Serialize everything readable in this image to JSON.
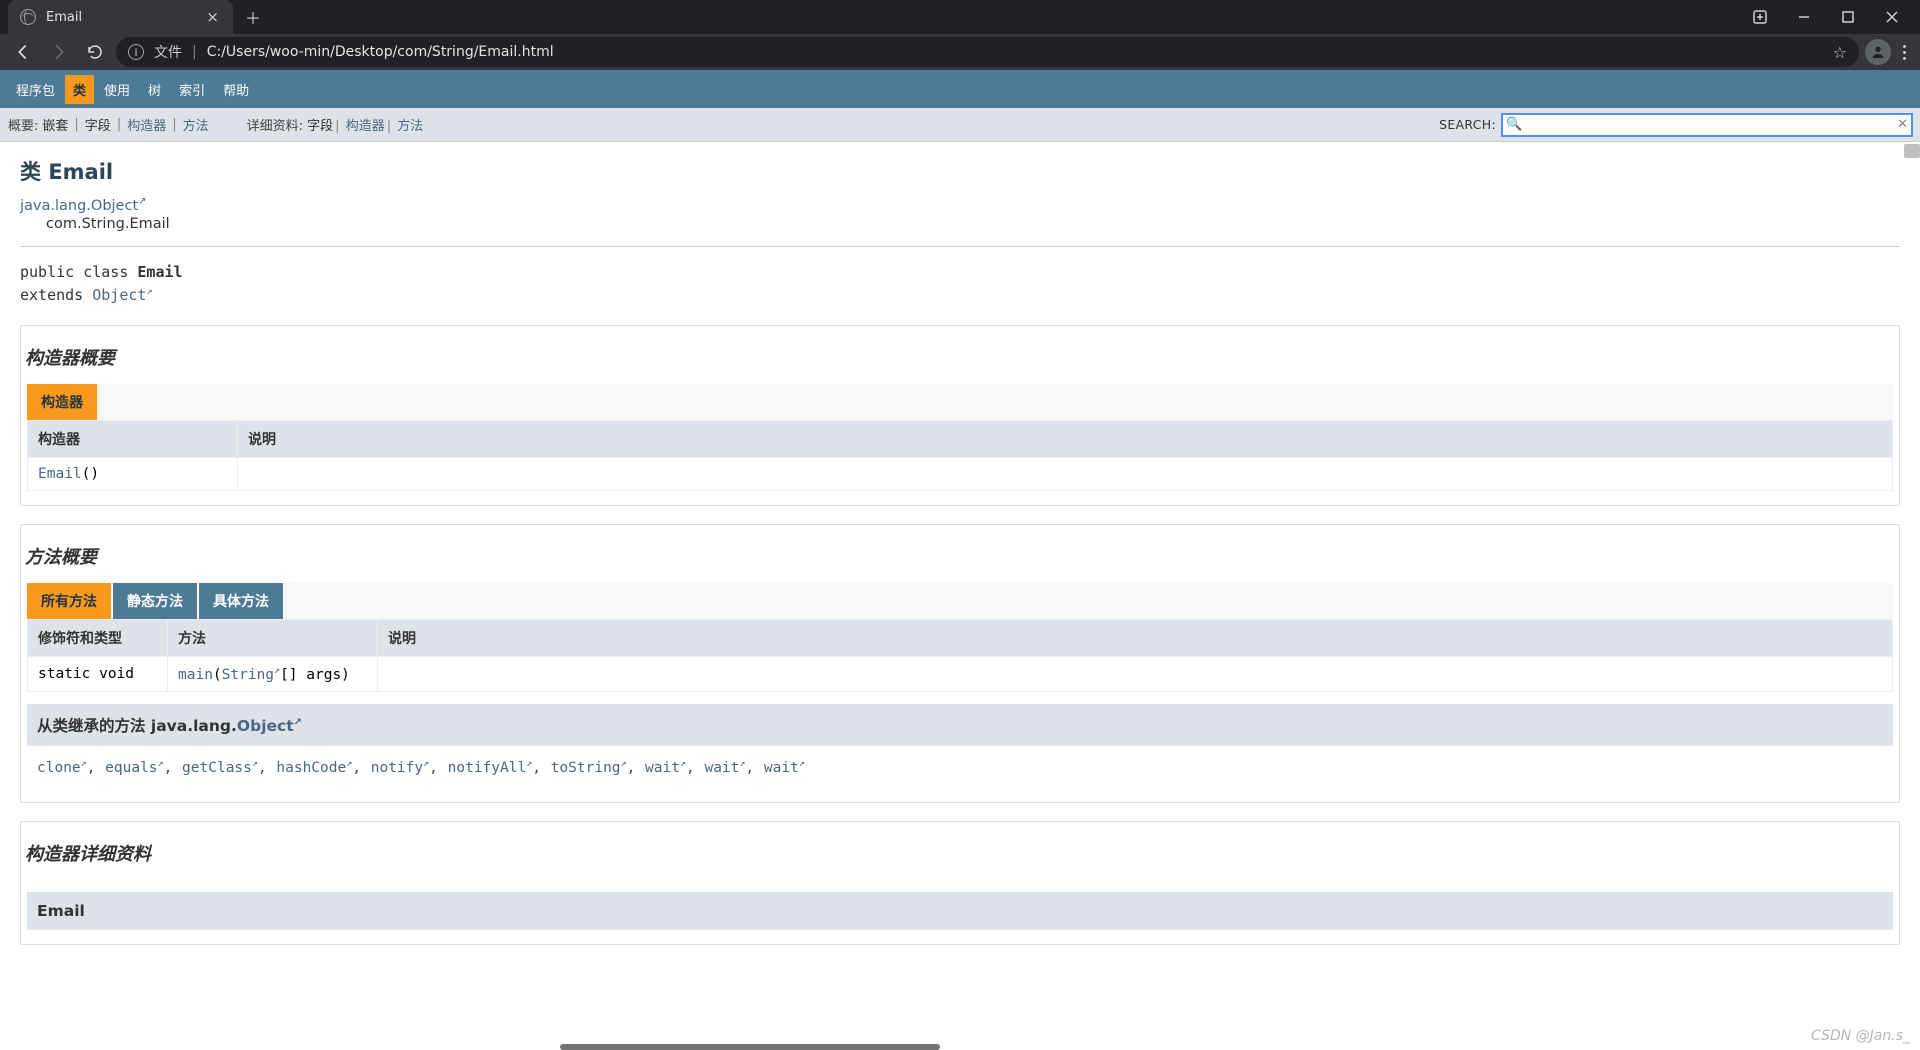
{
  "browser": {
    "tab_title": "Email",
    "url_prefix": "文件",
    "url": "C:/Users/woo-min/Desktop/com/String/Email.html"
  },
  "nav": {
    "items": [
      "程序包",
      "类",
      "使用",
      "树",
      "索引",
      "帮助"
    ],
    "active_index": 1
  },
  "subnav": {
    "summary_label": "概要:",
    "summary_items": [
      "嵌套",
      "字段",
      "构造器",
      "方法"
    ],
    "summary_link_idx": [
      2,
      3
    ],
    "detail_label": "详细资料:",
    "detail_items": [
      "字段",
      "构造器",
      "方法"
    ],
    "detail_link_idx": [
      1,
      2
    ],
    "search_label": "SEARCH:",
    "search_value": ""
  },
  "class": {
    "title_prefix": "类 ",
    "name": "Email",
    "super_link": "java.lang.Object",
    "full_name": "com.String.Email",
    "decl_public_class": "public class ",
    "decl_extends": "extends ",
    "decl_super": "Object"
  },
  "constructor_summary": {
    "heading": "构造器概要",
    "tab": "构造器",
    "col_constructor": "构造器",
    "col_desc": "说明",
    "rows": [
      {
        "name": "Email",
        "sig_suffix": "()",
        "desc": ""
      }
    ]
  },
  "method_summary": {
    "heading": "方法概要",
    "tabs": [
      "所有方法",
      "静态方法",
      "具体方法"
    ],
    "active_tab": 0,
    "col_mod": "修饰符和类型",
    "col_method": "方法",
    "col_desc": "说明",
    "rows": [
      {
        "modifiers": "static void",
        "name": "main",
        "param_open": "(",
        "param_type": "String",
        "param_rest": "[] args)",
        "desc": ""
      }
    ]
  },
  "inherited": {
    "heading_prefix": "从类继承的方法 java.lang.",
    "heading_link": "Object",
    "methods": [
      "clone",
      "equals",
      "getClass",
      "hashCode",
      "notify",
      "notifyAll",
      "toString",
      "wait",
      "wait",
      "wait"
    ]
  },
  "constructor_detail": {
    "heading": "构造器详细资料",
    "name": "Email"
  },
  "watermark": "CSDN @Jan.s_"
}
